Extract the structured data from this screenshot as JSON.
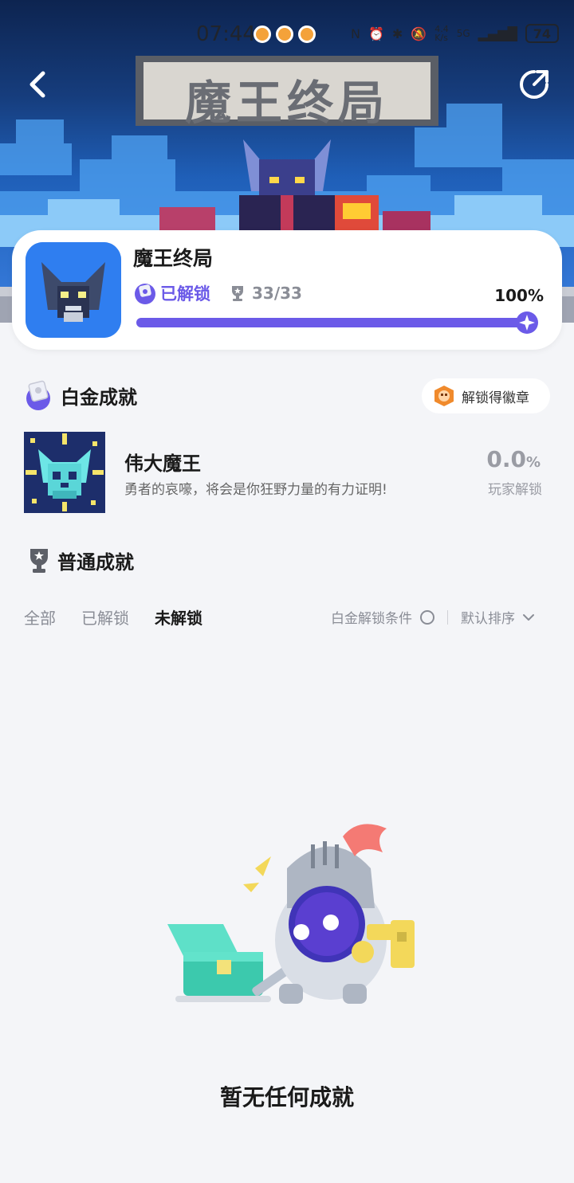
{
  "status_bar": {
    "time": "07:44",
    "network_speed": "4.4\nK/s",
    "network": "5G",
    "battery": "74"
  },
  "banner": {
    "logo_text": "魔王终局"
  },
  "game": {
    "title": "魔王终局",
    "unlock_label": "已解锁",
    "trophy_count": "33/33",
    "progress_percent": "100%",
    "progress_fraction": 1.0
  },
  "platinum": {
    "section_title": "白金成就",
    "badge_button": "解锁得徽章",
    "item": {
      "name": "伟大魔王",
      "description": "勇者的哀嚎，将会是你狂野力量的有力证明!",
      "rate": "0.0",
      "rate_unit": "%",
      "rate_label": "玩家解锁"
    }
  },
  "normal": {
    "section_title": "普通成就",
    "tabs": [
      {
        "label": "全部",
        "active": false
      },
      {
        "label": "已解锁",
        "active": false
      },
      {
        "label": "未解锁",
        "active": true
      }
    ],
    "filter_label": "白金解锁条件",
    "sort_label": "默认排序"
  },
  "empty_state": {
    "text": "暂无任何成就"
  },
  "colors": {
    "accent": "#6b5ae8",
    "page_bg": "#f4f5f8"
  }
}
